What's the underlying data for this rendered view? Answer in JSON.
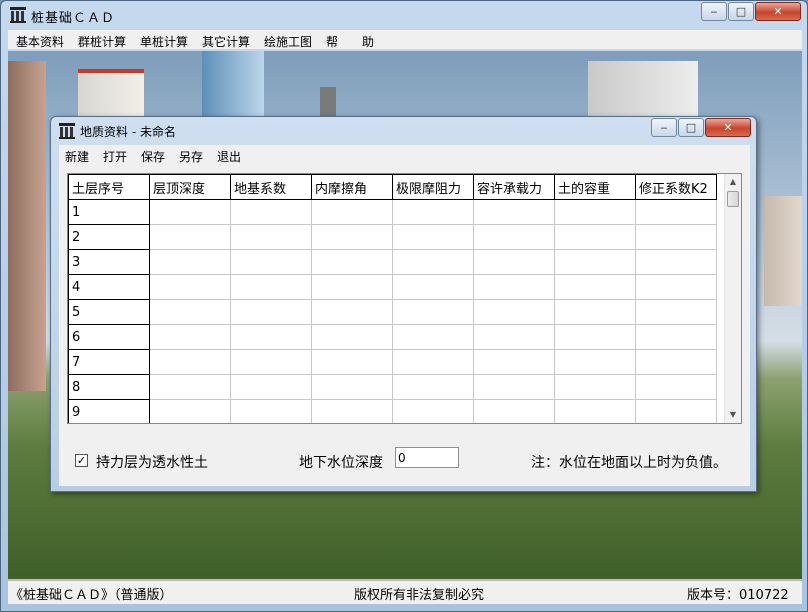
{
  "main": {
    "title": "桩基础ＣＡＤ",
    "caption_buttons": {
      "minimize": "‒",
      "maximize": "□",
      "close": "✕"
    }
  },
  "menubar": {
    "items": [
      "基本资料",
      "群桩计算",
      "单桩计算",
      "其它计算",
      "绘施工图",
      "帮",
      "助"
    ]
  },
  "child": {
    "title": "地质资料 - 未命名",
    "caption_buttons": {
      "minimize": "‒",
      "maximize": "□",
      "close": "✕"
    },
    "menu": [
      "新建",
      "打开",
      "保存",
      "另存",
      "退出"
    ],
    "grid": {
      "columns": [
        "土层序号",
        "层顶深度",
        "地基系数",
        "内摩擦角",
        "极限摩阻力",
        "容许承载力",
        "土的容重",
        "修正系数K2"
      ],
      "rows": [
        "1",
        "2",
        "3",
        "4",
        "5",
        "6",
        "7",
        "8",
        "9"
      ]
    },
    "checkbox": {
      "label": "持力层为透水性土",
      "checked": true,
      "mark": "✓"
    },
    "water_depth": {
      "label": "地下水位深度",
      "value": "0"
    },
    "note": "注：水位在地面以上时为负值。"
  },
  "status": {
    "left": "《桩基础ＣＡＤ》（普通版）",
    "center": "版权所有非法复制必究",
    "right": "版本号：010722"
  },
  "colors": {
    "titlebar": "#b4cbe3",
    "close_button": "#c7442c",
    "menubar": "#f0f0f0"
  }
}
